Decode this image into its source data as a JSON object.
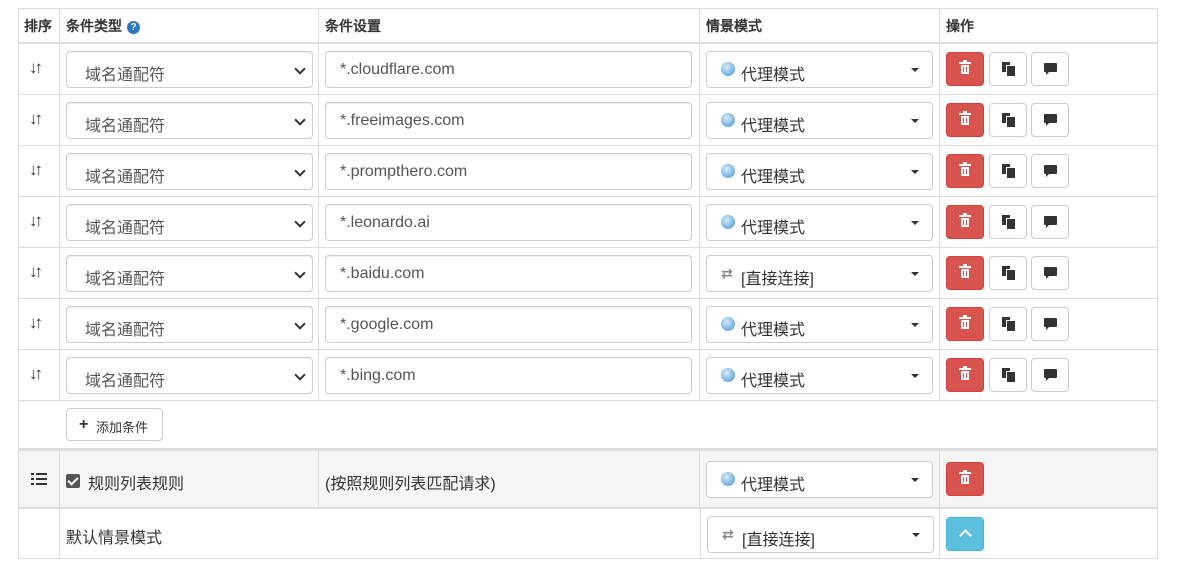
{
  "header": {
    "sort": "排序",
    "condition_type": "条件类型",
    "condition_setting": "条件设置",
    "profile": "情景模式",
    "actions": "操作"
  },
  "rows": [
    {
      "type": "域名通配符",
      "pattern": "*.cloudflare.com",
      "profile": "代理模式",
      "profile_icon": "globe-icon"
    },
    {
      "type": "域名通配符",
      "pattern": "*.freeimages.com",
      "profile": "代理模式",
      "profile_icon": "globe-icon"
    },
    {
      "type": "域名通配符",
      "pattern": "*.prompthero.com",
      "profile": "代理模式",
      "profile_icon": "globe-icon"
    },
    {
      "type": "域名通配符",
      "pattern": "*.leonardo.ai",
      "profile": "代理模式",
      "profile_icon": "globe-icon"
    },
    {
      "type": "域名通配符",
      "pattern": "*.baidu.com",
      "profile": "[直接连接]",
      "profile_icon": "swap-icon"
    },
    {
      "type": "域名通配符",
      "pattern": "*.google.com",
      "profile": "代理模式",
      "profile_icon": "globe-icon"
    },
    {
      "type": "域名通配符",
      "pattern": "*.bing.com",
      "profile": "代理模式",
      "profile_icon": "globe-icon"
    }
  ],
  "add_condition_label": "添加条件",
  "rule_list": {
    "label": "规则列表规则",
    "checked": true,
    "setting": "(按照规则列表匹配请求)",
    "profile": "代理模式"
  },
  "default_row": {
    "label": "默认情景模式",
    "profile": "[直接连接]"
  },
  "colors": {
    "danger": "#d9534f",
    "info": "#5bc0de",
    "help": "#2a78c2"
  }
}
